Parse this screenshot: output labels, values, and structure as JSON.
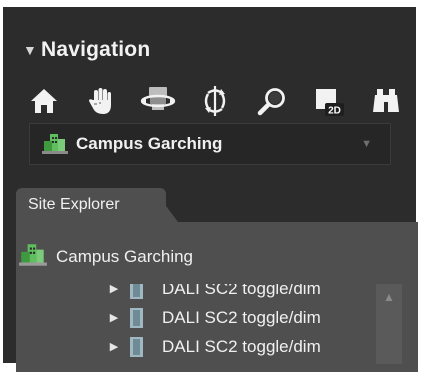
{
  "navigation": {
    "title": "Navigation",
    "tools": [
      {
        "name": "home-icon"
      },
      {
        "name": "hand-pan-icon"
      },
      {
        "name": "orbit-icon"
      },
      {
        "name": "rotate-icon"
      },
      {
        "name": "zoom-icon"
      },
      {
        "name": "view-2d-icon",
        "badge": "2D"
      },
      {
        "name": "binoculars-icon"
      }
    ]
  },
  "site_select": {
    "value": "Campus Garching",
    "icon": "building-icon",
    "caret": "▼"
  },
  "site_explorer": {
    "tab_label": "Site Explorer",
    "root": {
      "label": "Campus Garching",
      "icon": "building-icon"
    },
    "items": [
      {
        "label": "DALI SC2 toggle/dim",
        "icon": "device-icon",
        "expander": "▶"
      },
      {
        "label": "DALI SC2 toggle/dim",
        "icon": "device-icon",
        "expander": "▶"
      },
      {
        "label": "DALI SC2 toggle/dim",
        "icon": "device-icon",
        "expander": "▶"
      }
    ],
    "scroll_up": "▲"
  },
  "colors": {
    "panel_bg": "#2c2c2c",
    "explorer_bg": "#4f4f4f",
    "text": "#f0f0f0",
    "building_green": "#4aa84a"
  }
}
